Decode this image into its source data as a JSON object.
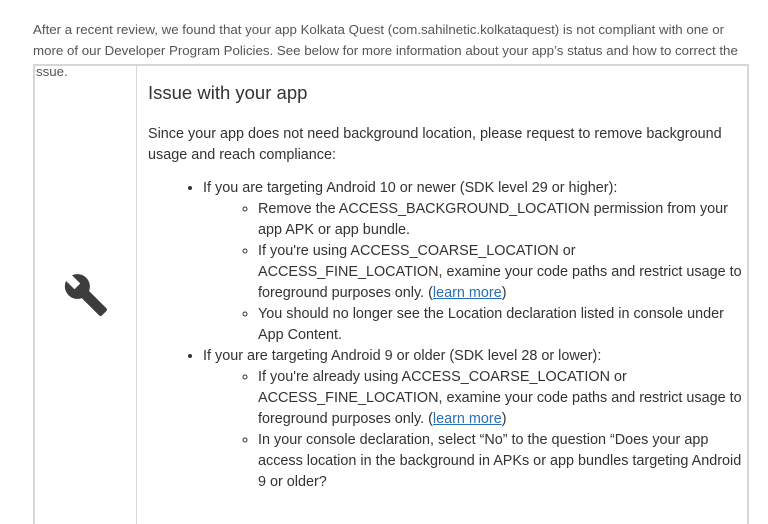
{
  "intro": {
    "text": "After a recent review, we found that your app Kolkata Quest (com.sahilnetic.kolkataquest) is not compliant with one or more of our Developer Program Policies. See below for more information about your app’s status and how to correct the issue."
  },
  "icon": "wrench-icon",
  "card": {
    "title": "Issue with your app",
    "lead": "Since your app does not need background location, please request to remove background usage and reach compliance:",
    "android10": {
      "label": "If you are targeting Android 10 or newer (SDK level 29 or higher):",
      "item1": "Remove the ACCESS_BACKGROUND_LOCATION permission from your app APK or app bundle.",
      "item2_text": "If you're using ACCESS_COARSE_LOCATION or ACCESS_FINE_LOCATION, examine your code paths and restrict usage to foreground purposes only. (",
      "item2_link": "learn more",
      "item2_close": ")",
      "item3": "You should no longer see the Location declaration listed in console under App Content."
    },
    "android9": {
      "label": "If your are targeting Android 9 or older (SDK level 28 or lower):",
      "item1_text": "If you're already using ACCESS_COARSE_LOCATION or ACCESS_FINE_LOCATION, examine your code paths and restrict usage to foreground purposes only. (",
      "item1_link": "learn more",
      "item1_close": ")",
      "item2": "In your console declaration, select “No” to the question “Does your app access location in the background in APKs or app bundles targeting Android 9 or older?"
    }
  },
  "colors": {
    "link": "#2a6fb5",
    "border": "#d6d6d6",
    "icon": "#3d3d3d"
  }
}
